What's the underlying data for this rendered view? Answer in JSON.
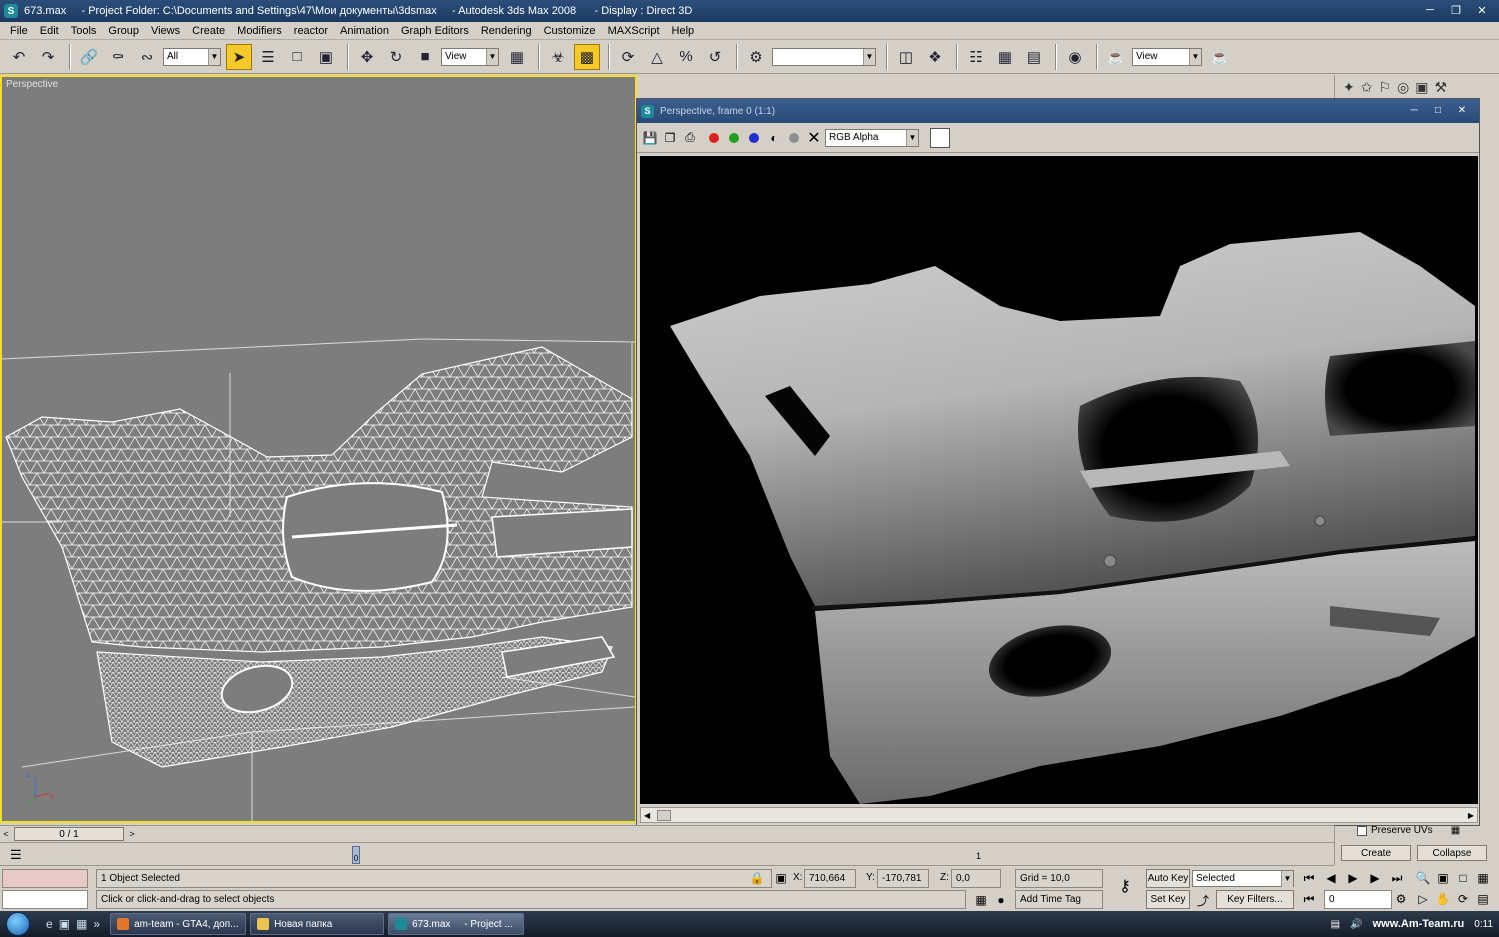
{
  "window": {
    "app_icon": "3ds-max-icon",
    "title": "673.max     - Project Folder: C:\\Documents and Settings\\47\\Мои документы\\3dsmax     - Autodesk 3ds Max 2008      - Display : Direct 3D"
  },
  "menu": [
    "File",
    "Edit",
    "Tools",
    "Group",
    "Views",
    "Create",
    "Modifiers",
    "reactor",
    "Animation",
    "Graph Editors",
    "Rendering",
    "Customize",
    "MAXScript",
    "Help"
  ],
  "toolbar": {
    "selection_filter": "All",
    "ref_coord_system": "View",
    "named_selection": "",
    "viewport_dropdown": "View"
  },
  "viewport": {
    "label": "Perspective"
  },
  "render_window": {
    "title": "Perspective, frame 0 (1:1)",
    "channel": "RGB Alpha"
  },
  "command_panel": {
    "preserve_uvs": "Preserve UVs",
    "create_btn": "Create",
    "collapse_btn": "Collapse"
  },
  "time_slider": {
    "value": "0 / 1",
    "left_arrow": "<",
    "right_arrow": ">"
  },
  "trackbar": {
    "tick_start": "0",
    "tick_end": "1"
  },
  "status": {
    "selection_info": "1 Object Selected",
    "prompt": "Click or click-and-drag to select objects",
    "x_label": "X:",
    "x_value": "710,664",
    "y_label": "Y:",
    "y_value": "-170,781",
    "z_label": "Z:",
    "z_value": "0,0",
    "grid": "Grid = 10,0",
    "add_time_tag": "Add Time Tag",
    "auto_key": "Auto Key",
    "set_key": "Set Key",
    "key_mode": "Selected",
    "key_filters": "Key Filters...",
    "frame": "0"
  },
  "taskbar": {
    "tasks": [
      {
        "label": "am-team - GTA4, доп...",
        "color": "#e0762a"
      },
      {
        "label": "Новая папка",
        "color": "#e8c350"
      },
      {
        "label": "673.max     - Project ...",
        "color": "#1d8a9a"
      }
    ],
    "watermark": "www.Am-Team.ru",
    "clock": "0:11"
  }
}
